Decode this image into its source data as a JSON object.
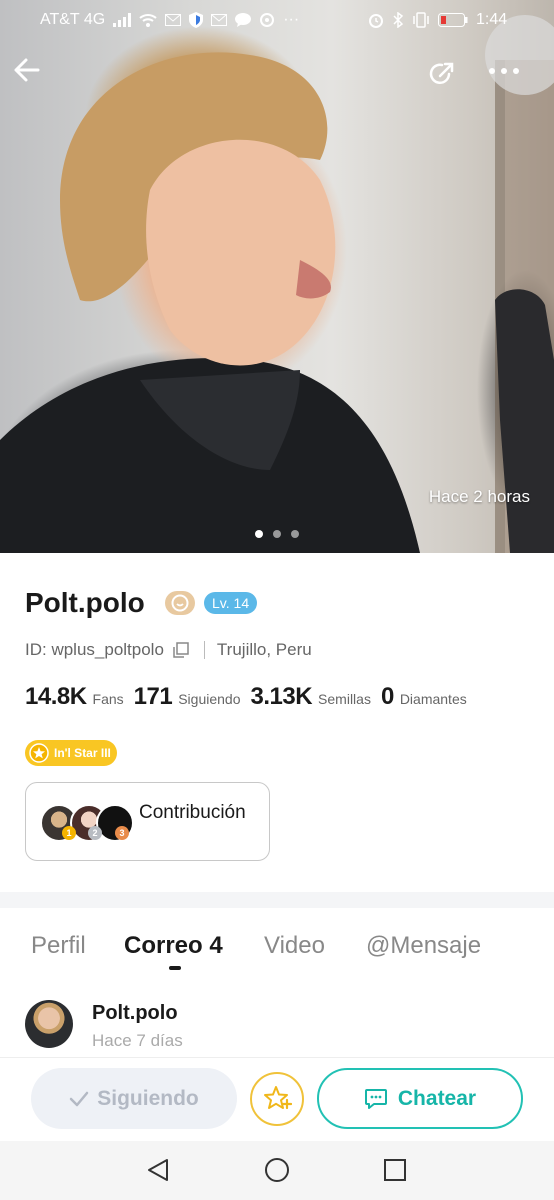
{
  "status_bar": {
    "carrier": "AT&T 4G",
    "time": "1:44"
  },
  "photo": {
    "timestamp": "Hace 2 horas",
    "page_count": 3,
    "active_page": 1
  },
  "profile": {
    "username": "Polt.polo",
    "level": "Lv. 14",
    "id_text": "ID: wplus_poltpolo",
    "location": "Trujillo, Peru",
    "stats": [
      {
        "value": "14.8K",
        "label": "Fans"
      },
      {
        "value": "171",
        "label": "Siguiendo"
      },
      {
        "value": "3.13K",
        "label": "Semillas"
      },
      {
        "value": "0",
        "label": "Diamantes"
      }
    ],
    "star_badge": "In'l Star III",
    "contribution_label": "Contribución",
    "contribution_ranks": [
      "1",
      "2",
      "3"
    ]
  },
  "tabs": [
    {
      "label": "Perfil"
    },
    {
      "label": "Correo 4"
    },
    {
      "label": "Video"
    },
    {
      "label": "@Mensaje"
    }
  ],
  "post": {
    "author": "Polt.polo",
    "time": "Hace 7 días"
  },
  "actions": {
    "following": "Siguiendo",
    "chat": "Chatear"
  },
  "colors": {
    "accent_teal": "#22c1b4",
    "level_blue": "#5bb8e8",
    "star_yellow": "#f9c623"
  }
}
